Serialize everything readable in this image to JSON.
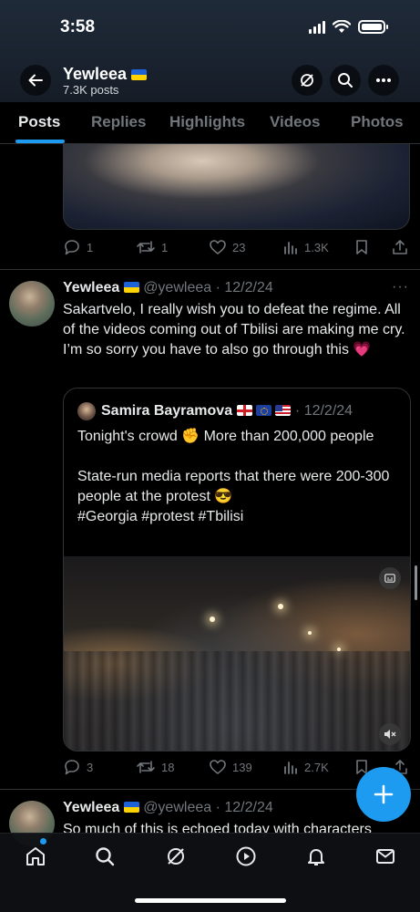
{
  "status_bar": {
    "time": "3:58"
  },
  "header": {
    "name": "Yewleea",
    "name_flag": "ukraine-flag",
    "post_count": "7.3K posts"
  },
  "tabs": [
    {
      "label": "Posts",
      "active": true
    },
    {
      "label": "Replies"
    },
    {
      "label": "Highlights"
    },
    {
      "label": "Videos"
    },
    {
      "label": "Photos"
    }
  ],
  "prev_post_actions": {
    "replies": "1",
    "reposts": "1",
    "likes": "23",
    "views": "1.3K"
  },
  "tweet": {
    "name": "Yewleea",
    "handle": "@yewleea",
    "date": "12/2/24",
    "text": "Sakartvelo, I really wish you to defeat the regime. All of the videos coming out of Tbilisi are making me cry. I’m so sorry you have to also go through this 💗",
    "quote": {
      "name": "Samira Bayramova",
      "date": "12/2/24",
      "text": "Tonight's crowd ✊ More than 200,000 people\n\nState-run media reports that there were 200-300 people at the protest 😎\n#Georgia #protest #Tbilisi"
    },
    "actions": {
      "replies": "3",
      "reposts": "18",
      "likes": "139",
      "views": "2.7K"
    }
  },
  "next_tweet": {
    "name": "Yewleea",
    "handle": "@yewleea",
    "date": "12/2/24",
    "text_partial": "So much of this is echoed today with characters"
  },
  "colors": {
    "accent": "#1d9bf0",
    "muted": "#71767b",
    "text": "#e7e9ea",
    "background": "#000000"
  },
  "bottom_nav": [
    "home-icon",
    "search-icon",
    "grok-icon",
    "video-icon",
    "notifications-icon",
    "messages-icon"
  ]
}
